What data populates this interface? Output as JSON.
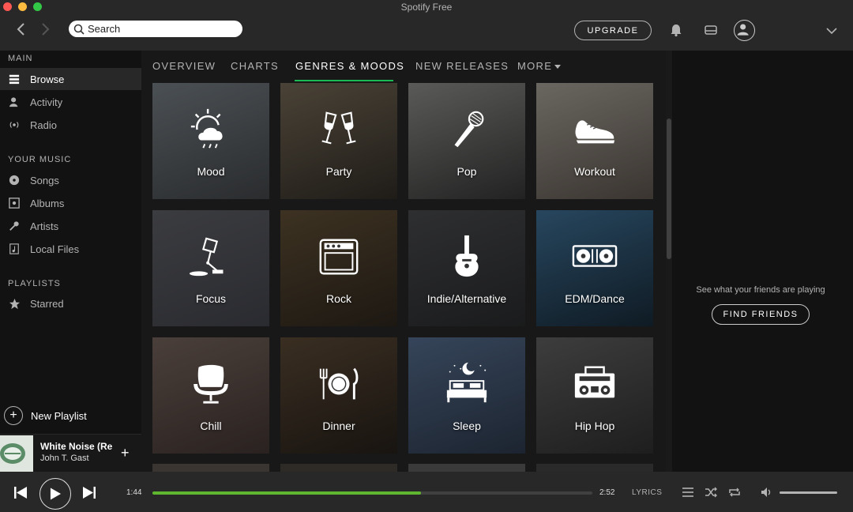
{
  "window": {
    "title": "Spotify Free"
  },
  "header": {
    "search_placeholder": "Search",
    "upgrade_label": "UPGRADE"
  },
  "sidebar": {
    "main_heading": "MAIN",
    "main_items": [
      {
        "label": "Browse",
        "icon": "browse-icon",
        "active": true
      },
      {
        "label": "Activity",
        "icon": "activity-icon"
      },
      {
        "label": "Radio",
        "icon": "radio-icon"
      }
    ],
    "your_music_heading": "YOUR MUSIC",
    "your_music_items": [
      {
        "label": "Songs",
        "icon": "songs-icon"
      },
      {
        "label": "Albums",
        "icon": "albums-icon"
      },
      {
        "label": "Artists",
        "icon": "artists-icon"
      },
      {
        "label": "Local Files",
        "icon": "local-files-icon"
      }
    ],
    "playlists_heading": "PLAYLISTS",
    "playlist_items": [
      {
        "label": "Starred",
        "icon": "star-icon"
      }
    ],
    "new_playlist_label": "New Playlist"
  },
  "now_playing": {
    "title": "White Noise (Re",
    "artist": "John T. Gast"
  },
  "tabs": [
    {
      "label": "OVERVIEW"
    },
    {
      "label": "CHARTS"
    },
    {
      "label": "GENRES & MOODS",
      "active": true
    },
    {
      "label": "NEW RELEASES"
    },
    {
      "label": "MORE"
    }
  ],
  "genres": [
    {
      "label": "Mood",
      "icon": "weather-icon",
      "colors": [
        "#4b5054",
        "#2a2c2e"
      ]
    },
    {
      "label": "Party",
      "icon": "champagne-icon",
      "colors": [
        "#4a4236",
        "#1f1c18"
      ]
    },
    {
      "label": "Pop",
      "icon": "microphone-icon",
      "colors": [
        "#5a5a58",
        "#222"
      ]
    },
    {
      "label": "Workout",
      "icon": "sneaker-icon",
      "colors": [
        "#6a6660",
        "#3a3530"
      ]
    },
    {
      "label": "Focus",
      "icon": "desk-lamp-icon",
      "colors": [
        "#3b3c40",
        "#2a2b30"
      ]
    },
    {
      "label": "Rock",
      "icon": "amplifier-icon",
      "colors": [
        "#3d3222",
        "#1d1812"
      ]
    },
    {
      "label": "Indie/Alternative",
      "icon": "guitar-icon",
      "colors": [
        "#2e2f31",
        "#1a1b1c"
      ]
    },
    {
      "label": "EDM/Dance",
      "icon": "turntables-icon",
      "colors": [
        "#27465e",
        "#0f1b24"
      ]
    },
    {
      "label": "Chill",
      "icon": "egg-chair-icon",
      "colors": [
        "#4a3f3a",
        "#2a2220"
      ]
    },
    {
      "label": "Dinner",
      "icon": "plate-cutlery-icon",
      "colors": [
        "#3a2e22",
        "#181410"
      ]
    },
    {
      "label": "Sleep",
      "icon": "bed-moon-icon",
      "colors": [
        "#36455a",
        "#1c2430"
      ]
    },
    {
      "label": "Hip Hop",
      "icon": "boombox-icon",
      "colors": [
        "#3d3d3d",
        "#1e1e1e"
      ]
    }
  ],
  "friends": {
    "text": "See what your friends are playing",
    "button_label": "FIND FRIENDS"
  },
  "player": {
    "current_time": "1:44",
    "total_time": "2:52",
    "progress_fraction": 0.61,
    "lyrics_label": "LYRICS",
    "volume_fraction": 1.0
  },
  "colors": {
    "accent": "#1db954",
    "progress": "#5fb72f",
    "sidebar_bg": "#121212",
    "main_bg": "#181818",
    "bar_bg": "#282828"
  }
}
